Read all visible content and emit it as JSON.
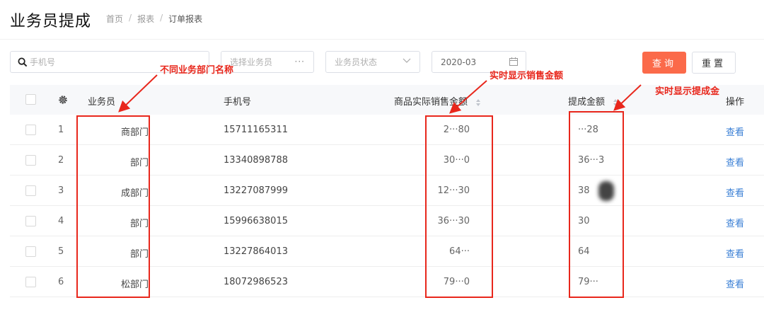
{
  "page": {
    "title": "业务员提成",
    "breadcrumb": [
      "首页",
      "报表",
      "订单报表"
    ],
    "separator": "/"
  },
  "filters": {
    "search_placeholder": "手机号",
    "agent_select_placeholder": "选择业务员",
    "agent_select_icon": "more-dots-icon",
    "agent_select_dots": "···",
    "status_select_placeholder": "业务员状态",
    "date_value": "2020-03",
    "query_button": "查询",
    "reset_button": "重置"
  },
  "table": {
    "columns": {
      "agent": "业务员",
      "phone": "手机号",
      "sales": "商品实际销售金额",
      "commission": "提成金额",
      "action": "操作"
    },
    "rows": [
      {
        "index": "1",
        "agent": "商部门",
        "phone": "15711165311",
        "sales": "2···80",
        "commission": "···28",
        "action": "查看"
      },
      {
        "index": "2",
        "agent": "部门",
        "phone": "13340898788",
        "sales": "30···0",
        "commission": "36···3",
        "action": "查看"
      },
      {
        "index": "3",
        "agent": "成部门",
        "phone": "13227087999",
        "sales": "12···30",
        "commission": "38",
        "action": "查看"
      },
      {
        "index": "4",
        "agent": "部门",
        "phone": "15996638015",
        "sales": "36···30",
        "commission": "30",
        "action": "查看"
      },
      {
        "index": "5",
        "agent": "部门",
        "phone": "13227864013",
        "sales": "64···",
        "commission": "64",
        "action": "查看"
      },
      {
        "index": "6",
        "agent": "松部门",
        "phone": "18072986523",
        "sales": "79···0",
        "commission": "79···",
        "action": "查看"
      }
    ]
  },
  "annotations": {
    "department_note": "不同业务部门名称",
    "sales_note": "实时显示销售金额",
    "commission_note": "实时显示提成金",
    "color": "#e8271c"
  },
  "colors": {
    "primary_button": "#fb6a4a",
    "link": "#3a7fd5",
    "header_bg": "#f7f8fa"
  }
}
